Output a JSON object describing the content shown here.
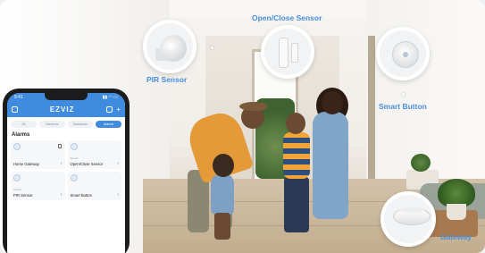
{
  "labels": {
    "pir": "PIR Sensor",
    "open_close": "Open/Close Sensor",
    "smart_button": "Smart Button",
    "gateway": "Gateway"
  },
  "phone": {
    "status_time": "9:41",
    "status_icons": "▮▮ ◠ ▭",
    "logo": "EZVIZ",
    "tabs": [
      {
        "label": "All",
        "active": false
      },
      {
        "label": "Cameras",
        "active": false
      },
      {
        "label": "Standards",
        "active": false
      },
      {
        "label": "Alarms",
        "active": true
      }
    ],
    "section_title": "Alarms",
    "cards": [
      {
        "sub": "",
        "name": "Home Gateway"
      },
      {
        "sub": "Armed",
        "name": "Open/Close Sensor"
      },
      {
        "sub": "Armed",
        "name": "PIR Sensor"
      },
      {
        "sub": "",
        "name": "Smart Button"
      }
    ]
  },
  "colors": {
    "accent": "#3f8be0",
    "label": "#4a8fd9"
  },
  "icons": [
    "pir-sensor-icon",
    "open-close-sensor-icon",
    "smart-button-icon",
    "gateway-icon",
    "menu-icon",
    "plus-icon",
    "bell-icon",
    "chevron-right-icon"
  ]
}
